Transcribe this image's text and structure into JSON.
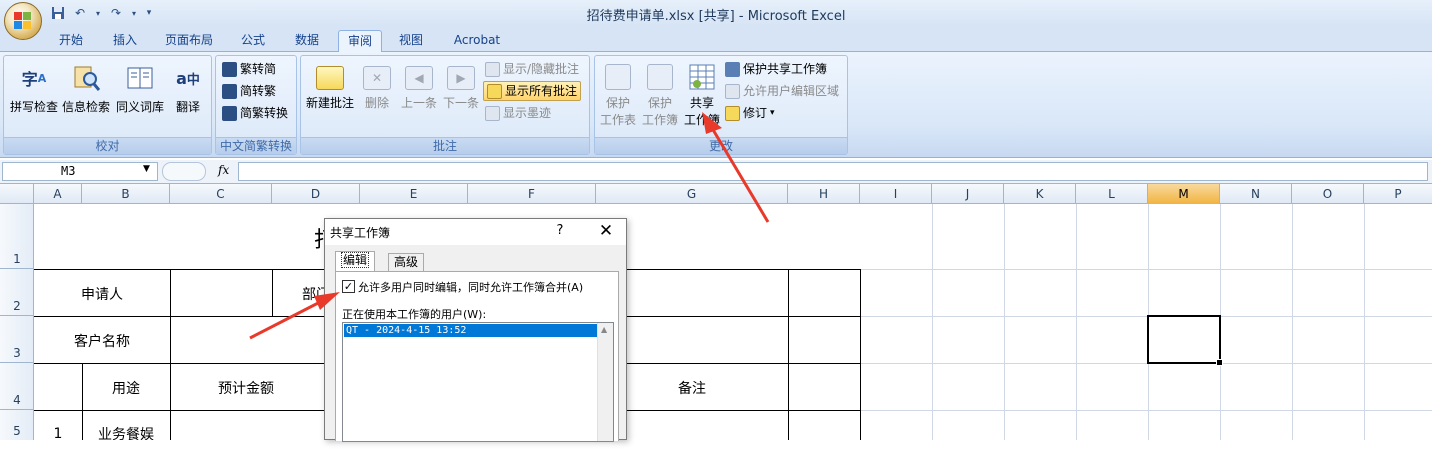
{
  "app": {
    "window_title": "招待费申请单.xlsx  [共享] - Microsoft Excel"
  },
  "tabs": [
    "开始",
    "插入",
    "页面布局",
    "公式",
    "数据",
    "审阅",
    "视图",
    "Acrobat"
  ],
  "active_tab": "审阅",
  "ribbon": {
    "proofing": {
      "label": "校对",
      "spelling": "拼写检查",
      "research": "信息检索",
      "thesaurus": "同义词库",
      "translate": "翻译"
    },
    "chinese_conversion": {
      "label": "中文简繁转换",
      "to_simplified": "繁转简",
      "to_traditional": "简转繁",
      "convert": "简繁转换"
    },
    "comments": {
      "label": "批注",
      "new": "新建批注",
      "delete": "删除",
      "previous": "上一条",
      "next": "下一条",
      "show_hide": "显示/隐藏批注",
      "show_all": "显示所有批注",
      "show_ink": "显示墨迹"
    },
    "changes": {
      "label": "更改",
      "protect_sheet_1": "保护",
      "protect_sheet_2": "工作表",
      "protect_workbook_1": "保护",
      "protect_workbook_2": "工作簿",
      "share_workbook_1": "共享",
      "share_workbook_2": "工作簿",
      "protect_share": "保护共享工作簿",
      "allow_edit_ranges": "允许用户编辑区域",
      "track_changes": "修订"
    }
  },
  "formula_bar": {
    "name_box": "M3",
    "fx": "fx",
    "formula": ""
  },
  "columns": [
    "A",
    "B",
    "C",
    "D",
    "E",
    "F",
    "G",
    "H",
    "I",
    "J",
    "K",
    "L",
    "M",
    "N",
    "O",
    "P"
  ],
  "active_column": "M",
  "rows": [
    "1",
    "2",
    "3",
    "4",
    "5"
  ],
  "sheet": {
    "title_partial": "打",
    "applicant": "申请人",
    "department_partial": "部门",
    "customer": "客户名称",
    "purpose": "用途",
    "estimated_amount": "预计金额",
    "remarks": "备注",
    "row1_no": "1",
    "row1_purpose": "业务餐娱"
  },
  "dialog": {
    "title": "共享工作簿",
    "help": "?",
    "close": "✕",
    "tab_edit": "编辑",
    "tab_advanced": "高级",
    "allow_checked": true,
    "check_mark": "✓",
    "allow_label": "允许多用户同时编辑，同时允许工作簿合并(A)",
    "users_label": "正在使用本工作簿的用户(W):",
    "users": [
      "QT - 2024-4-15 13:52"
    ]
  },
  "icons": {
    "office": "office-logo-icon",
    "save": "save-icon",
    "undo": "undo-icon",
    "redo": "redo-icon"
  },
  "colors": {
    "accent": "#15428b",
    "annotation": "#e8392a",
    "selection": "#0078d7"
  }
}
